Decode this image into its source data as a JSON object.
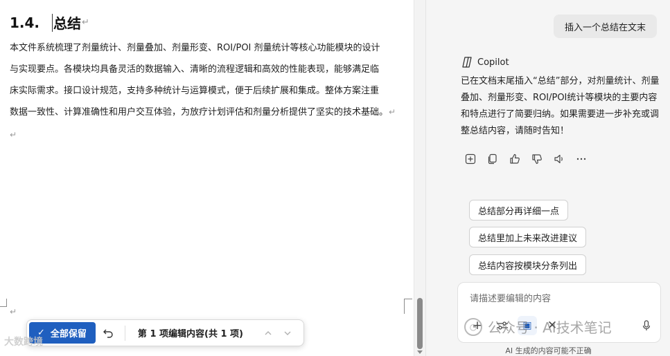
{
  "document": {
    "heading_number": "1.4.",
    "heading_text": "总结",
    "paragraph_mark": "↵",
    "body_lines": [
      "本文件系统梳理了剂量统计、剂量叠加、剂量形变、ROI/POI 剂量统计等核心功能模块的设计",
      "与实现要点。各模块均具备灵活的数据输入、清晰的流程逻辑和高效的性能表现，能够满足临",
      "床实际需求。接口设计规范，支持多种统计与运算模式，便于后续扩展和集成。整体方案注重",
      "数据一致性、计算准确性和用户交互体验，为放疗计划评估和剂量分析提供了坚实的技术基础。"
    ]
  },
  "review_bar": {
    "keep_all_label": "全部保留",
    "edit_count_label": "第 1 项编辑内容(共 1 项)"
  },
  "watermarks": {
    "left": "大数跨境",
    "right": "公众号 · AI技术笔记"
  },
  "copilot": {
    "user_message": "插入一个总结在文末",
    "assistant_name": "Copilot",
    "reply_text": "已在文档末尾插入“总结”部分，对剂量统计、剂量叠加、剂量形变、ROI/POI统计等模块的主要内容和特点进行了简要归纳。如果需要进一步补充或调整总结内容，请随时告知！",
    "suggestions": [
      "总结部分再详细一点",
      "总结里加上未来改进建议",
      "总结内容按模块分条列出"
    ],
    "composer_placeholder": "请描述要编辑的内容",
    "disclaimer": "AI 生成的内容可能不正确",
    "action_icons": [
      "insert-icon",
      "copy-icon",
      "thumbs-up-icon",
      "thumbs-down-icon",
      "read-aloud-icon",
      "more-icon"
    ],
    "accent_color": "#1f5fbf"
  }
}
